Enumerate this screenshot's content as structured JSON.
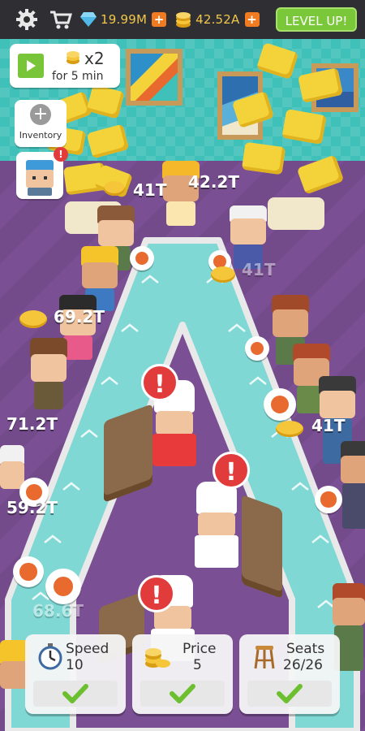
{
  "hud": {
    "gems": "19.99M",
    "coins": "42.52A",
    "level_up_label": "LEVEL UP!",
    "icons": [
      "gear-icon",
      "cart-icon",
      "gem-icon",
      "coin-stack-icon",
      "plus-icon"
    ],
    "accent": "#7ac83a",
    "plus_color": "#f07b21"
  },
  "boost": {
    "multiplier": "x2",
    "duration": "for 5 min"
  },
  "inventory": {
    "label": "Inventory"
  },
  "character_alert": "!",
  "earnings": [
    {
      "text": "41T"
    },
    {
      "text": "42.2T"
    },
    {
      "text": "41T"
    },
    {
      "text": "69.2T"
    },
    {
      "text": "71.2T"
    },
    {
      "text": "41T"
    },
    {
      "text": "59.2T"
    },
    {
      "text": "68.6T"
    }
  ],
  "chef_alerts": [
    "!",
    "!",
    "!"
  ],
  "upgrades": [
    {
      "name": "Speed",
      "value": "10",
      "icon": "stopwatch-icon"
    },
    {
      "name": "Price",
      "value": "5",
      "icon": "coin-stack-icon"
    },
    {
      "name": "Seats",
      "value": "26/26",
      "icon": "stool-icon"
    }
  ]
}
